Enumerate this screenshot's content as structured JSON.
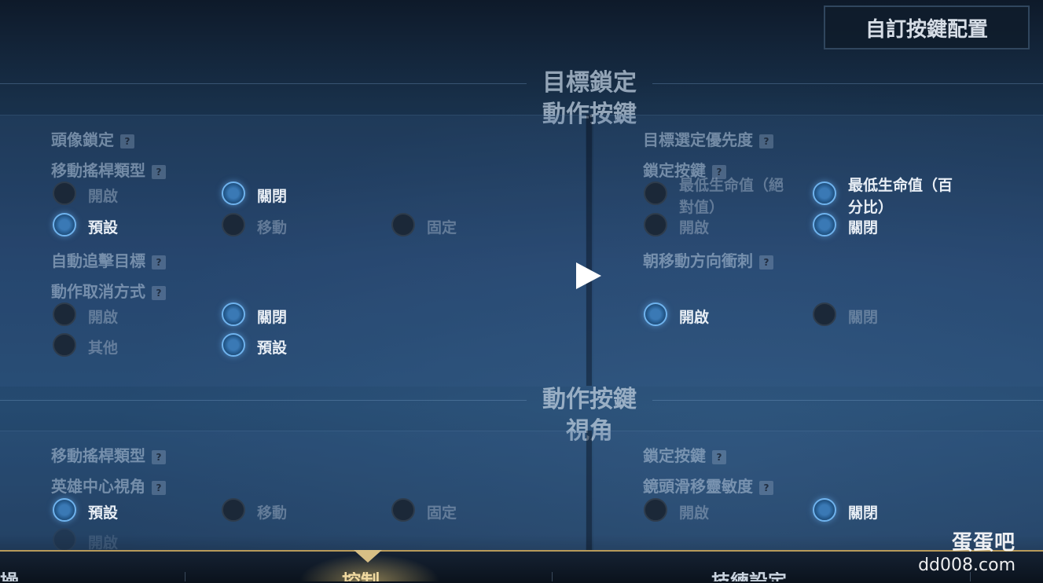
{
  "header": {
    "custom_button": "自訂按鍵配置"
  },
  "sections": {
    "target_lock": {
      "title_line1": "目標鎖定",
      "title_line2": "動作按鍵"
    },
    "camera": {
      "title_line1": "動作按鍵",
      "title_line2": "視角"
    }
  },
  "left1": {
    "avatar_lock": "頭像鎖定",
    "joystick_type": "移動搖桿類型",
    "opt_on": "開啟",
    "opt_off": "關閉",
    "opt_default": "預設",
    "opt_move": "移動",
    "opt_fixed": "固定",
    "auto_chase": "自動追擊目標",
    "cancel_mode": "動作取消方式",
    "cancel_on": "開啟",
    "cancel_off": "關閉",
    "cancel_other": "其他",
    "cancel_default": "預設"
  },
  "right1": {
    "priority": "目標選定優先度",
    "lock_button": "鎖定按鍵",
    "lowest_hp_abs_1": "最低生命值（絕",
    "lowest_hp_abs_2": "對值）",
    "lowest_hp_pct_1": "最低生命值（百",
    "lowest_hp_pct_2": "分比）",
    "lock_on": "開啟",
    "lock_off": "關閉",
    "dash": "朝移動方向衝刺",
    "dash_on": "開啟",
    "dash_off": "關閉"
  },
  "left2": {
    "joystick_type": "移動搖桿類型",
    "hero_center": "英雄中心視角",
    "opt_default": "預設",
    "opt_move": "移動",
    "opt_fixed": "固定",
    "opt_on": "開啟"
  },
  "right2": {
    "lock_button": "鎖定按鍵",
    "camera_sensitivity": "鏡頭滑移靈敏度",
    "opt_on": "開啟",
    "opt_off": "關閉"
  },
  "tabs": [
    "操",
    "控制",
    "技練設定"
  ],
  "watermark": {
    "name": "蛋蛋吧",
    "url": "dd008.com"
  },
  "colors": {
    "accent_gold": "#b89a5a",
    "radio_on": "#3a79b5"
  }
}
